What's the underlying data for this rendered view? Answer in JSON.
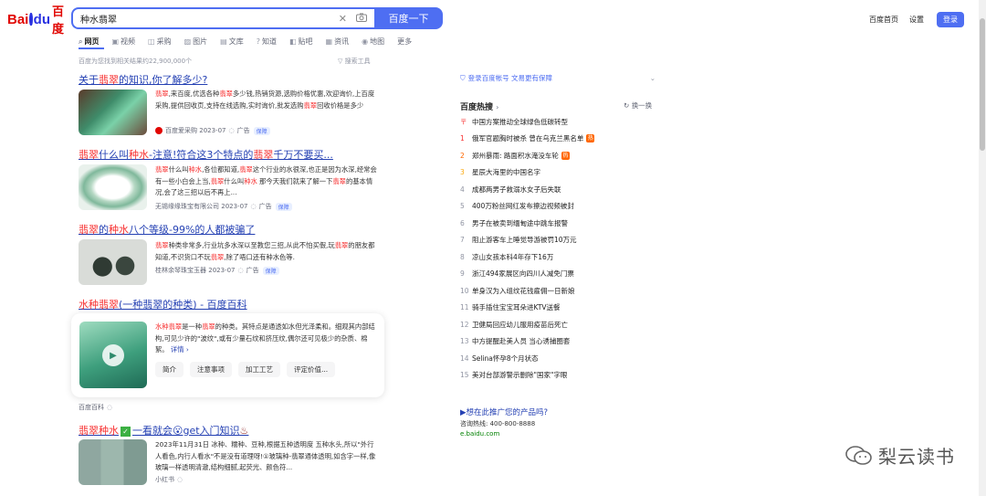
{
  "header": {
    "logo_left": "Bai",
    "logo_right": "du",
    "logo_cn": "百度",
    "query": "种水翡翠",
    "search_button": "百度一下",
    "home": "百度首页",
    "settings": "设置",
    "login": "登录"
  },
  "tabs": [
    {
      "label": "网页",
      "icon": "search-icon"
    },
    {
      "label": "视频",
      "icon": "video-icon"
    },
    {
      "label": "采购",
      "icon": "cart-icon"
    },
    {
      "label": "图片",
      "icon": "image-icon"
    },
    {
      "label": "文库",
      "icon": "doc-icon"
    },
    {
      "label": "知道",
      "icon": "question-icon"
    },
    {
      "label": "贴吧",
      "icon": "forum-icon"
    },
    {
      "label": "资讯",
      "icon": "news-icon"
    },
    {
      "label": "地图",
      "icon": "map-icon"
    },
    {
      "label": "更多",
      "icon": ""
    }
  ],
  "result_count": "百度为您找到相关结果约22,900,000个",
  "search_tools": "搜索工具",
  "results": [
    {
      "title_pre": "关于",
      "title_em": "翡翠",
      "title_post": "的知识,你了解多少?",
      "desc_em1": "翡翠",
      "desc_1": ",来百度,优选各种",
      "desc_em2": "翡翠",
      "desc_2": "多少钱,热销货源,选购价格优惠,欢迎询价,上百度采购,提供回收页,支持在线选购,实时询价,批发选购",
      "desc_em3": "翡翠",
      "desc_3": "回收价格是多少",
      "source": "百度爱采购",
      "date": "2023-07",
      "ad": "广告",
      "badge": "保障"
    },
    {
      "title_em1": "翡翠",
      "title_mid": "什么叫",
      "title_em2": "种水",
      "title_post": "-注意!符合这3个特点的",
      "title_em3": "翡翠",
      "title_end": "千万不要买...",
      "desc_em1": "翡翠",
      "desc_1": "什么叫",
      "desc_em2": "种水",
      "desc_2": ",各位都知道,",
      "desc_em3": "翡翠",
      "desc_3": "这个行业的水很深,也正是因为水深,经常会有一些小白会上当,",
      "desc_em4": "翡翠",
      "desc_4": "什么叫",
      "desc_em5": "种水",
      "desc_5": " 那今天我们就来了解一下",
      "desc_em6": "翡翠",
      "desc_6": "的基本情况,会了这三招以后不再上...",
      "source": "无锡缘缘珠宝有限公司",
      "date": "2023-07",
      "ad": "广告",
      "badge": "保障"
    },
    {
      "title_em1": "翡翠",
      "title_mid": "的",
      "title_em2": "种水",
      "title_post": "八个等级-99%的人都被骗了",
      "desc_em1": "翡翠",
      "desc_1": "种类非常多,行业坑多水深以至教您三招,从此不怕买假,玩",
      "desc_em2": "翡翠",
      "desc_2": "的朋友都知道,不识货口不玩",
      "desc_em3": "翡翠",
      "desc_3": ",除了唔口还有种水色等.",
      "source": "桂林余琴珠宝玉器",
      "date": "2023-07",
      "ad": "广告",
      "badge": "保障"
    }
  ],
  "baike": {
    "title_em1": "水种翡翠",
    "title_post": "(一种翡翠的种类) - 百度百科",
    "desc_em1": "水种翡翠",
    "desc_1": "是一种",
    "desc_em2": "翡翠",
    "desc_2": "的种类。其特点是通透如水但光泽柔和。细观其内部结构,可见少许的\"波纹\",或有少量石纹和挤压纹,偶尔还可见极少的杂质、棉絮。",
    "more": "详情",
    "chips": [
      "简介",
      "注意事项",
      "加工工艺",
      "评定价值..."
    ],
    "source": "百度百科"
  },
  "xhs": {
    "title_em1": "翡翠种水",
    "title_post": "一看就会",
    "title_end": "get入门知识",
    "desc": "2023年11月31日 冰种、糯种、豆种,根据五种透明度 五种水头,所以\"外行人看色,内行人看水\"不是没有道理呀!①玻璃种-翡翠通体透明,如含字一样,像玻璃一样透明清澈,结构细腻,起荧光、颜色符...",
    "desc_em": "翡翠",
    "source": "小红书"
  },
  "right": {
    "login_tip": "登录百度帐号 文易更有保障",
    "hot_title": "百度热搜",
    "refresh": "换一换",
    "hot_items": [
      {
        "n": "",
        "text": "中国方案推动全球绿色低碳转型",
        "tag": ""
      },
      {
        "n": "1",
        "text": "俄军官题胸时被杀 曾在乌克兰黑名单",
        "tag": "热"
      },
      {
        "n": "2",
        "text": "郑州暴雨: 路面积水淹没车轮",
        "tag": "热"
      },
      {
        "n": "3",
        "text": "星辰大海里的中国名字",
        "tag": ""
      },
      {
        "n": "4",
        "text": "成都两男子救溺水女子后失联",
        "tag": ""
      },
      {
        "n": "5",
        "text": "400万粉丝网红发布擦边视频被封",
        "tag": ""
      },
      {
        "n": "6",
        "text": "男子在被卖到缅甸途中跳车报警",
        "tag": ""
      },
      {
        "n": "7",
        "text": "阻止游客车上睡觉导游被罚10万元",
        "tag": ""
      },
      {
        "n": "8",
        "text": "凉山女孩本科4年存下16万",
        "tag": ""
      },
      {
        "n": "9",
        "text": "浙江494家展区向四川人减免门票",
        "tag": ""
      },
      {
        "n": "10",
        "text": "单身汉为入组纹花钱雇佣一日新娘",
        "tag": ""
      },
      {
        "n": "11",
        "text": "骑手插住宝宝耳朵进KTV送餐",
        "tag": ""
      },
      {
        "n": "12",
        "text": "卫健局回应幼儿服用疫苗后死亡",
        "tag": ""
      },
      {
        "n": "13",
        "text": "中方提醒赴美人员 当心诱捕圈套",
        "tag": ""
      },
      {
        "n": "14",
        "text": "Selina怀孕8个月状态",
        "tag": ""
      },
      {
        "n": "15",
        "text": "美对台部游警示删除\"国家\"字眼",
        "tag": ""
      }
    ],
    "promo_title": "▶想在此推广您的产品吗?",
    "promo_phone": "咨询热线: 400-800-8888",
    "promo_url": "e.baidu.com"
  },
  "watermark": "梨云读书"
}
